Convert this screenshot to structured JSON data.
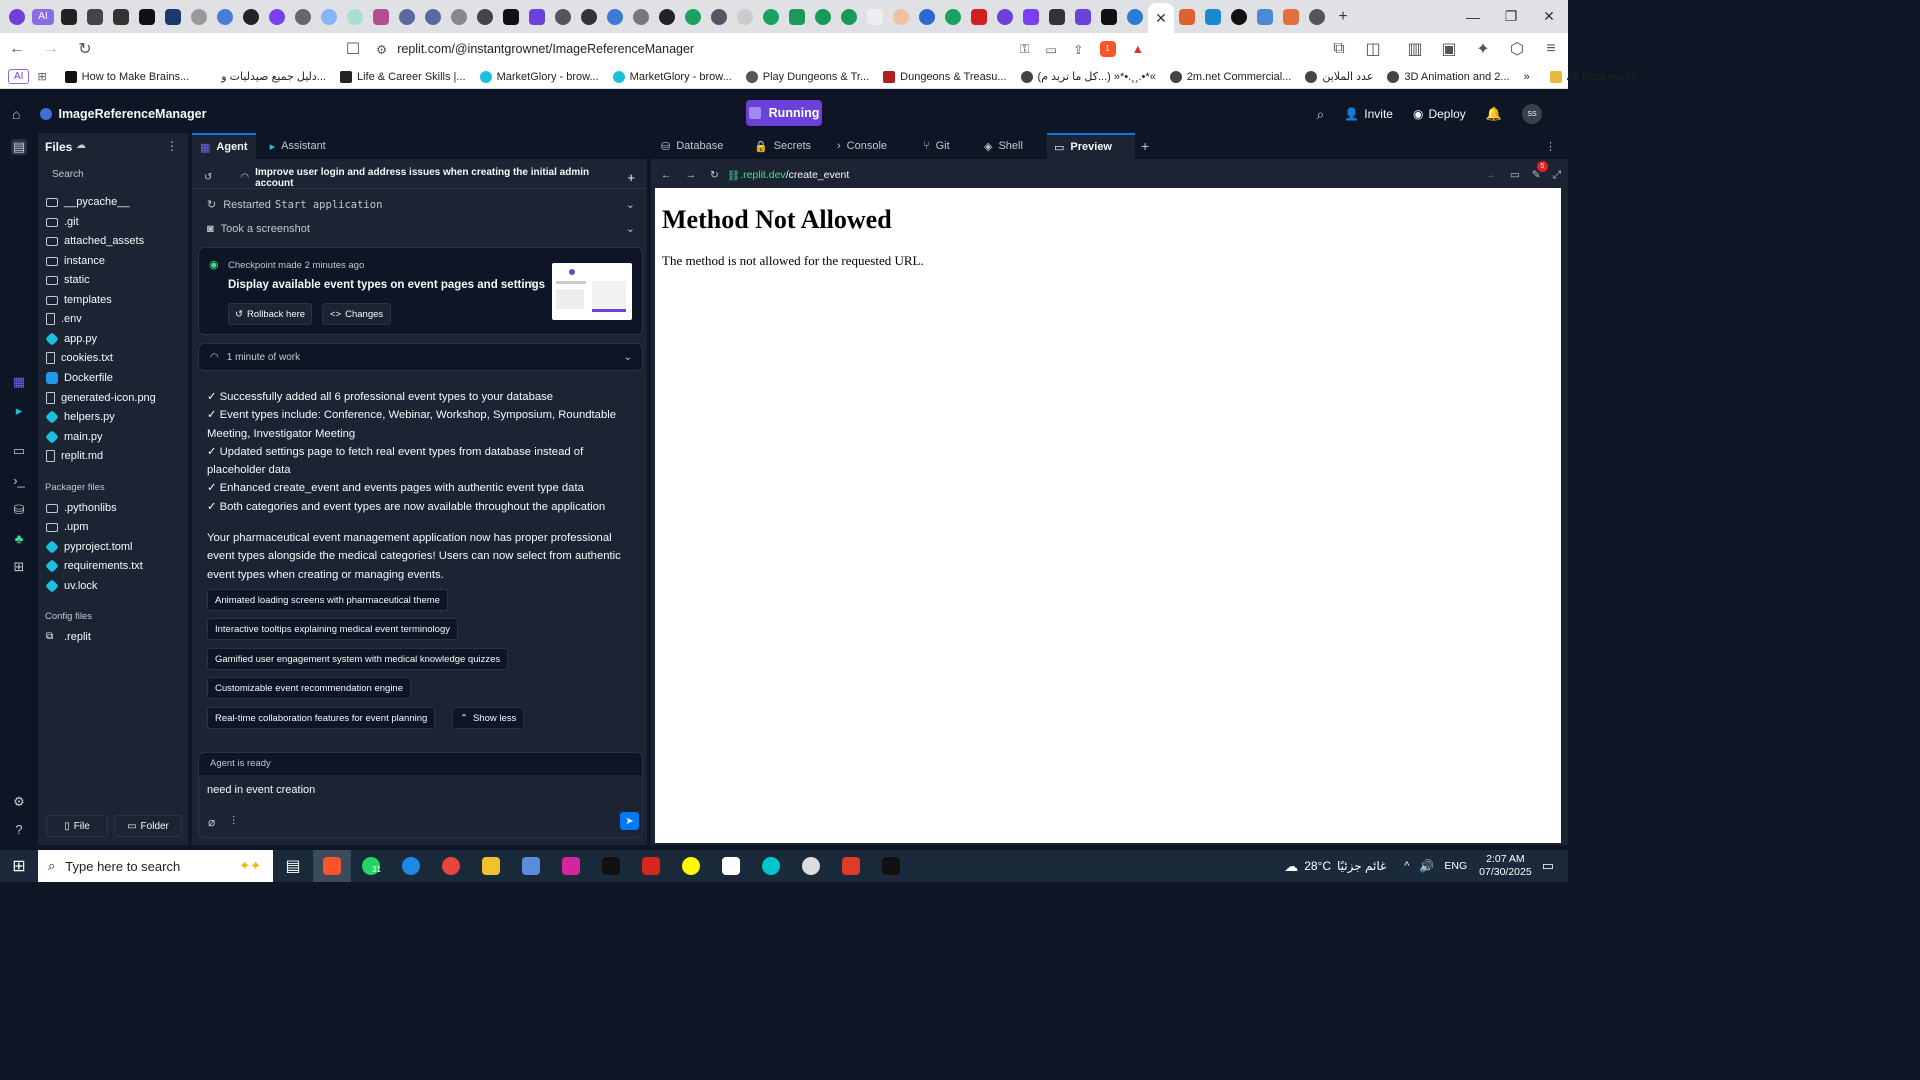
{
  "browser": {
    "address": "replit.com/@instantgrownet/ImageReferenceManager",
    "bookmarks": [
      "How to Make Brains...",
      "دليل جميع صيدليات و...",
      "Life & Career Skills |...",
      "MarketGlory - brow...",
      "MarketGlory - brow...",
      "Play Dungeons & Tr...",
      "Dungeons & Treasu...",
      "(كل ما تريد م...) »*•.¸¸.•*«",
      "2m.net Commercial...",
      "عدد الملاين",
      "3D Animation and 2..."
    ],
    "all_bookmarks": "All Bookmarks",
    "ai_label": "AI",
    "brave_badge": "1"
  },
  "header": {
    "project_name": "ImageReferenceManager",
    "run_label": "Running",
    "invite_label": "Invite",
    "deploy_label": "Deploy",
    "avatar_initials": "SS"
  },
  "files": {
    "title": "Files",
    "search_placeholder": "Search",
    "items": [
      "__pycache__",
      ".git",
      "attached_assets",
      "instance",
      "static",
      "templates",
      ".env",
      "app.py",
      "cookies.txt",
      "Dockerfile",
      "generated-icon.png",
      "helpers.py",
      "main.py",
      "replit.md"
    ],
    "packager_title": "Packager files",
    "packager_items": [
      ".pythonlibs",
      ".upm",
      "pyproject.toml",
      "requirements.txt",
      "uv.lock"
    ],
    "config_title": "Config files",
    "config_items": [
      ".replit"
    ],
    "new_file": "File",
    "new_folder": "Folder"
  },
  "agent": {
    "tab_agent": "Agent",
    "tab_assistant": "Assistant",
    "thread_title": "Improve user login and address issues when creating the initial admin account",
    "restarted_prefix": "Restarted",
    "restarted_cmd": "Start application",
    "screenshot": "Took a screenshot",
    "checkpoint_meta": "Checkpoint made 2 minutes ago",
    "checkpoint_title": "Display available event types on event pages and settings",
    "rollback": "Rollback here",
    "changes": "Changes",
    "work_time": "1 minute of work",
    "bullets": [
      "✓ Successfully added all 6 professional event types to your database",
      "✓ Event types include: Conference, Webinar, Workshop, Symposium, Roundtable Meeting, Investigator Meeting",
      "✓ Updated settings page to fetch real event types from database instead of placeholder data",
      "✓ Enhanced create_event and events pages with authentic event type data",
      "✓ Both categories and event types are now available throughout the application"
    ],
    "summary": "Your pharmaceutical event management application now has proper professional event types alongside the medical categories! Users can now select from authentic event types when creating or managing events.",
    "suggestions": [
      "Animated loading screens with pharmaceutical theme",
      "Interactive tooltips explaining medical event terminology",
      "Gamified user engagement system with medical knowledge quizzes",
      "Customizable event recommendation engine",
      "Real-time collaboration features for event planning"
    ],
    "show_less": "Show less",
    "status": "Agent is ready",
    "input_value": "need in event creation"
  },
  "panes": {
    "tabs": [
      "Database",
      "Secrets",
      "Console",
      "Git",
      "Shell",
      "Preview"
    ],
    "url_host": ".replit.dev",
    "url_path": "/create_event",
    "badge": "5"
  },
  "preview": {
    "heading": "Method Not Allowed",
    "body": "The method is not allowed for the requested URL."
  },
  "taskbar": {
    "search_placeholder": "Type here to search",
    "whatsapp_badge": "31",
    "weather_temp": "28°C",
    "weather_desc": "غائم جزئيًا",
    "lang": "ENG",
    "time": "2:07 AM",
    "date": "07/30/2025"
  },
  "colors": {
    "accent": "#6c41d9",
    "replit_bg": "#0e1525",
    "panel_bg": "#1c2333",
    "link_green": "#3ee08f",
    "send_blue": "#0079f2"
  }
}
